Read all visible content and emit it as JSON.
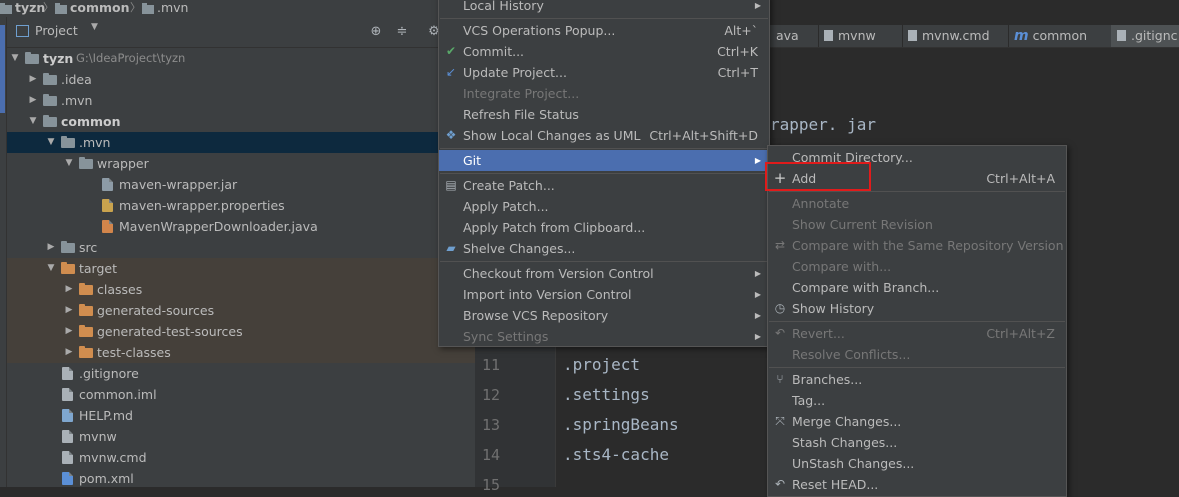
{
  "breadcrumb": {
    "items": [
      "tyzn",
      "common",
      ".mvn"
    ]
  },
  "project_panel": {
    "title": "Project",
    "tree": [
      {
        "label": "tyzn",
        "path": "G:\\IdeaProject\\tyzn",
        "depth": 0,
        "expanded": true,
        "bold": true,
        "icon": "module-folder"
      },
      {
        "label": ".idea",
        "depth": 1,
        "expanded": false,
        "icon": "folder"
      },
      {
        "label": ".mvn",
        "depth": 1,
        "expanded": false,
        "icon": "folder"
      },
      {
        "label": "common",
        "depth": 1,
        "expanded": true,
        "bold": true,
        "icon": "module-folder"
      },
      {
        "label": ".mvn",
        "depth": 2,
        "expanded": true,
        "selected": true,
        "icon": "folder"
      },
      {
        "label": "wrapper",
        "depth": 3,
        "expanded": true,
        "icon": "folder"
      },
      {
        "label": "maven-wrapper.jar",
        "depth": 4,
        "icon": "jar-file"
      },
      {
        "label": "maven-wrapper.properties",
        "depth": 4,
        "icon": "properties-file"
      },
      {
        "label": "MavenWrapperDownloader.java",
        "depth": 4,
        "icon": "java-file"
      },
      {
        "label": "src",
        "depth": 2,
        "expanded": false,
        "icon": "folder"
      },
      {
        "label": "target",
        "depth": 2,
        "expanded": true,
        "excluded": true,
        "icon": "excluded-folder"
      },
      {
        "label": "classes",
        "depth": 3,
        "expanded": false,
        "excluded": true,
        "icon": "excluded-folder"
      },
      {
        "label": "generated-sources",
        "depth": 3,
        "expanded": false,
        "excluded": true,
        "icon": "excluded-folder"
      },
      {
        "label": "generated-test-sources",
        "depth": 3,
        "expanded": false,
        "excluded": true,
        "icon": "excluded-folder"
      },
      {
        "label": "test-classes",
        "depth": 3,
        "expanded": false,
        "excluded": true,
        "icon": "excluded-folder"
      },
      {
        "label": ".gitignore",
        "depth": 2,
        "icon": "text-file"
      },
      {
        "label": "common.iml",
        "depth": 2,
        "icon": "iml-file"
      },
      {
        "label": "HELP.md",
        "depth": 2,
        "icon": "markdown-file"
      },
      {
        "label": "mvnw",
        "depth": 2,
        "icon": "text-file"
      },
      {
        "label": "mvnw.cmd",
        "depth": 2,
        "icon": "text-file"
      },
      {
        "label": "pom.xml",
        "depth": 2,
        "icon": "maven-file"
      }
    ]
  },
  "editor_tabs": [
    "ava",
    "mvnw",
    "mvnw.cmd",
    "common",
    ".gitignc"
  ],
  "editor": {
    "partial_text": "rapper. jar",
    "lines": [
      {
        "num": "11",
        "text": ".project"
      },
      {
        "num": "12",
        "text": ".settings"
      },
      {
        "num": "13",
        "text": ".springBeans"
      },
      {
        "num": "14",
        "text": ".sts4-cache"
      },
      {
        "num": "15",
        "text": ""
      }
    ]
  },
  "vcs_menu": {
    "items": [
      {
        "label": "Local History",
        "submenu": true,
        "partial": true
      },
      {
        "separator": true
      },
      {
        "label": "VCS Operations Popup...",
        "shortcut": "Alt+`"
      },
      {
        "label": "Commit...",
        "shortcut": "Ctrl+K",
        "icon": "check-icon"
      },
      {
        "label": "Update Project...",
        "shortcut": "Ctrl+T",
        "icon": "update-icon"
      },
      {
        "label": "Integrate Project...",
        "disabled": true
      },
      {
        "label": "Refresh File Status"
      },
      {
        "label": "Show Local Changes as UML",
        "shortcut": "Ctrl+Alt+Shift+D",
        "icon": "uml-icon"
      },
      {
        "separator": true
      },
      {
        "label": "Git",
        "submenu": true,
        "highlight": true
      },
      {
        "separator": true
      },
      {
        "label": "Create Patch...",
        "icon": "patch-icon"
      },
      {
        "label": "Apply Patch..."
      },
      {
        "label": "Apply Patch from Clipboard..."
      },
      {
        "label": "Shelve Changes...",
        "icon": "shelve-icon"
      },
      {
        "separator": true
      },
      {
        "label": "Checkout from Version Control",
        "submenu": true
      },
      {
        "label": "Import into Version Control",
        "submenu": true
      },
      {
        "label": "Browse VCS Repository",
        "submenu": true
      },
      {
        "label": "Sync Settings",
        "submenu": true,
        "disabled": true
      }
    ]
  },
  "git_menu": {
    "items": [
      {
        "label": "Commit Directory..."
      },
      {
        "label": "Add",
        "shortcut": "Ctrl+Alt+A",
        "icon": "plus-icon",
        "boxed": true
      },
      {
        "separator": true
      },
      {
        "label": "Annotate",
        "disabled": true
      },
      {
        "label": "Show Current Revision",
        "disabled": true
      },
      {
        "label": "Compare with the Same Repository Version",
        "disabled": true,
        "icon": "compare-icon"
      },
      {
        "label": "Compare with...",
        "disabled": true
      },
      {
        "label": "Compare with Branch..."
      },
      {
        "label": "Show History",
        "icon": "history-icon"
      },
      {
        "separator": true
      },
      {
        "label": "Revert...",
        "shortcut": "Ctrl+Alt+Z",
        "disabled": true,
        "icon": "revert-icon"
      },
      {
        "label": "Resolve Conflicts...",
        "disabled": true
      },
      {
        "separator": true
      },
      {
        "label": "Branches...",
        "icon": "branch-icon"
      },
      {
        "label": "Tag..."
      },
      {
        "label": "Merge Changes...",
        "icon": "merge-icon"
      },
      {
        "label": "Stash Changes..."
      },
      {
        "label": "UnStash Changes..."
      },
      {
        "label": "Reset HEAD...",
        "icon": "reset-icon",
        "partial": true
      }
    ]
  },
  "colors": {
    "menu_bg": "#3c3f41",
    "highlight": "#4b6eaf",
    "selection": "#0d293e",
    "excluded_bg": "#45403a",
    "editor_bg": "#2b2b2b",
    "red_box": "#e01b1b",
    "commit_check": "#59a869"
  }
}
